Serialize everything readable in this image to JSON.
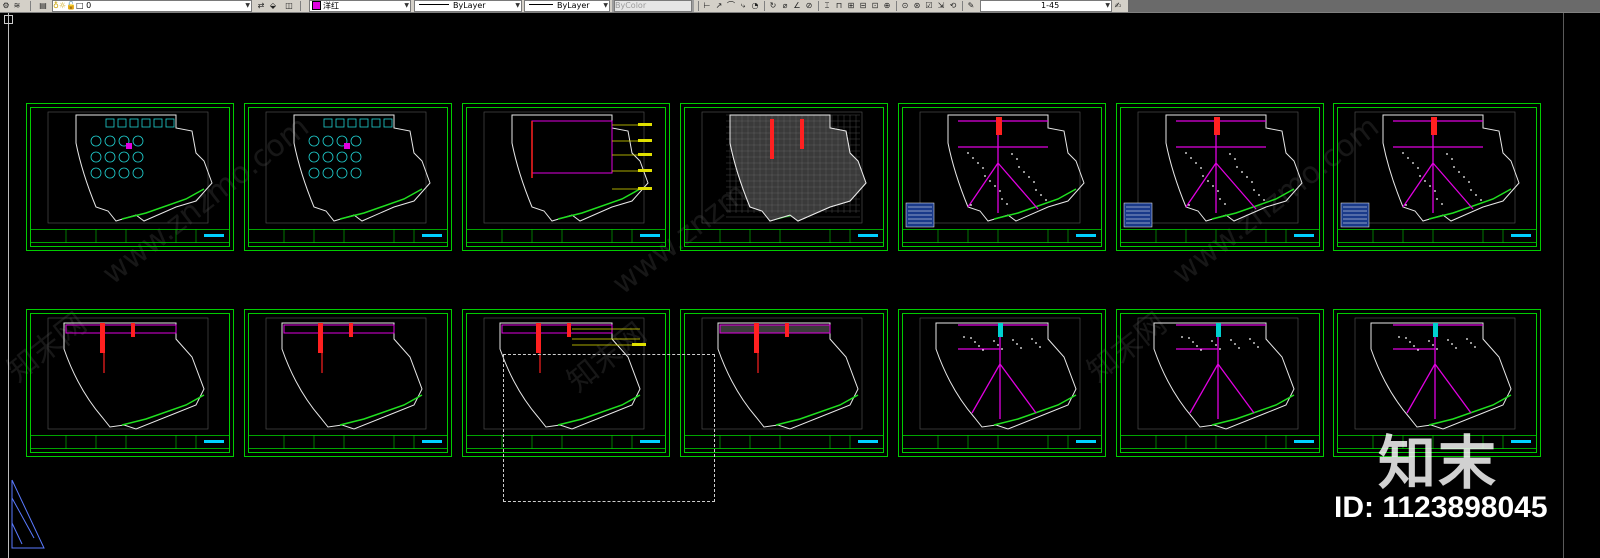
{
  "toolbar": {
    "layer_value": "0",
    "color_value": "洋红",
    "linetype_value": "ByLayer",
    "lineweight_value": "ByLayer",
    "plotstyle_value": "ByColor",
    "dimstyle_value": "1-45",
    "accent_magenta": "#e000e0"
  },
  "canvas": {
    "background": "#000000",
    "frame_color": "#00cc00",
    "sheet_rows": [
      {
        "row": 1,
        "sheets": [
          "furniture-plan-1",
          "furniture-plan-2",
          "dimension-plan",
          "floor-tile-plan",
          "ceiling-plan-1",
          "ceiling-plan-2",
          "ceiling-plan-3"
        ]
      },
      {
        "row": 2,
        "sheets": [
          "wall-plan-1",
          "wall-plan-2",
          "wall-dimension-plan",
          "wall-tile-plan",
          "electrical-plan-1",
          "electrical-plan-2",
          "electrical-plan-3"
        ]
      }
    ]
  },
  "watermark": {
    "site": "www.znzmo.com",
    "brand": "知末网",
    "logo": "知末",
    "id_label": "ID: 1123898045"
  }
}
